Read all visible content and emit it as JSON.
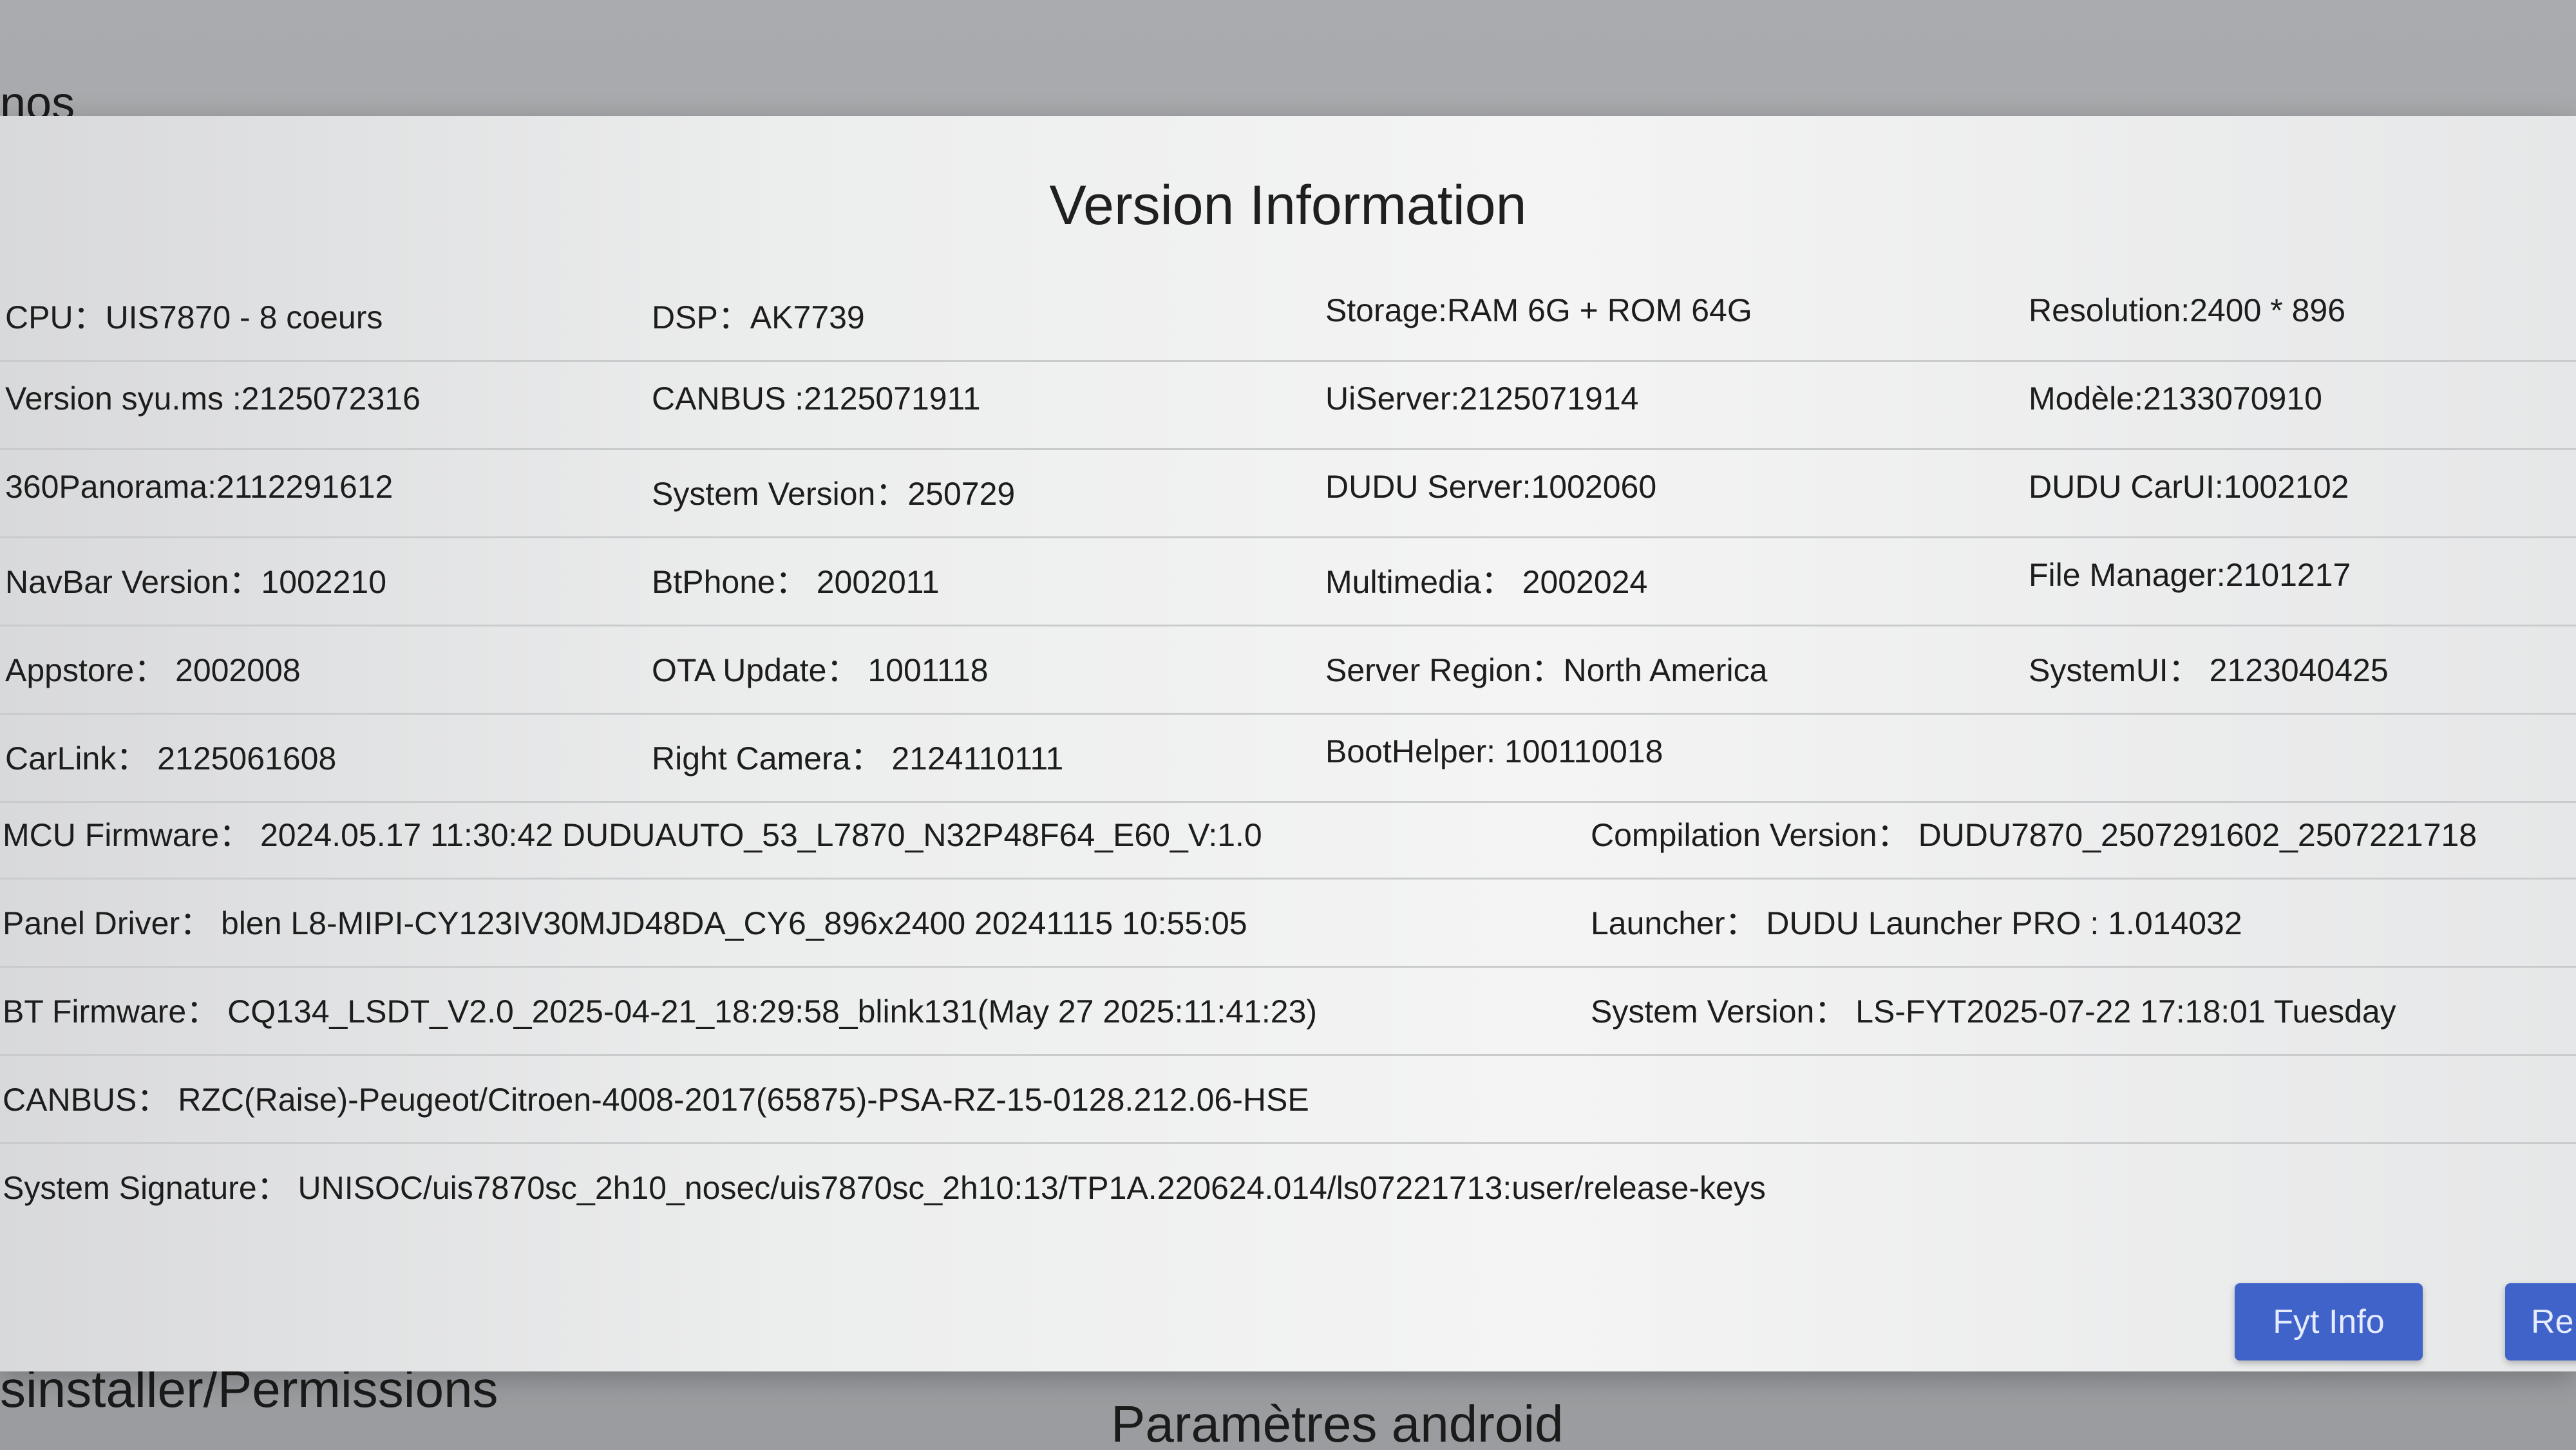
{
  "background": {
    "top_partial_label": "nos",
    "left_partial_label": "sinstaller/Permissions",
    "right_label": "Paramètres android"
  },
  "dialog": {
    "title": "Version Information",
    "grid": [
      [
        "CPU：UIS7870 - 8 coeurs",
        "DSP：AK7739",
        "Storage:RAM 6G + ROM 64G",
        "Resolution:2400 * 896"
      ],
      [
        "Version syu.ms :2125072316",
        "CANBUS :2125071911",
        "UiServer:2125071914",
        "Modèle:2133070910"
      ],
      [
        "360Panorama:2112291612",
        "System Version：250729",
        "DUDU Server:1002060",
        "DUDU CarUI:1002102"
      ],
      [
        "NavBar Version：1002210",
        "BtPhone：  2002011",
        "Multimedia：  2002024",
        "File Manager:2101217"
      ],
      [
        "Appstore：  2002008",
        "OTA Update：  1001118",
        "Server Region：North America",
        "SystemUI：  2123040425"
      ],
      [
        "CarLink：  2125061608",
        "Right Camera：  2124110111",
        "BootHelper: 100110018",
        ""
      ]
    ],
    "rows": [
      [
        "MCU Firmware：  2024.05.17 11:30:42 DUDUAUTO_53_L7870_N32P48F64_E60_V:1.0",
        "Compilation Version：  DUDU7870_2507291602_2507221718"
      ],
      [
        "Panel Driver：  blen L8-MIPI-CY123IV30MJD48DA_CY6_896x2400 20241115 10:55:05",
        "Launcher：  DUDU Launcher PRO : 1.014032"
      ],
      [
        "BT Firmware：  CQ134_LSDT_V2.0_2025-04-21_18:29:58_blink131(May 27 2025:11:41:23)",
        "System Version：  LS-FYT2025-07-22 17:18:01 Tuesday"
      ],
      [
        "CANBUS：  RZC(Raise)-Peugeot/Citroen-4008-2017(65875)-PSA-RZ-15-0128.212.06-HSE",
        ""
      ],
      [
        "System Signature：  UNISOC/uis7870sc_2h10_nosec/uis7870sc_2h10:13/TP1A.220624.014/ls07221713:user/release-keys",
        ""
      ]
    ],
    "buttons": {
      "fyt_info": "Fyt Info",
      "second_partial": "Re"
    }
  }
}
